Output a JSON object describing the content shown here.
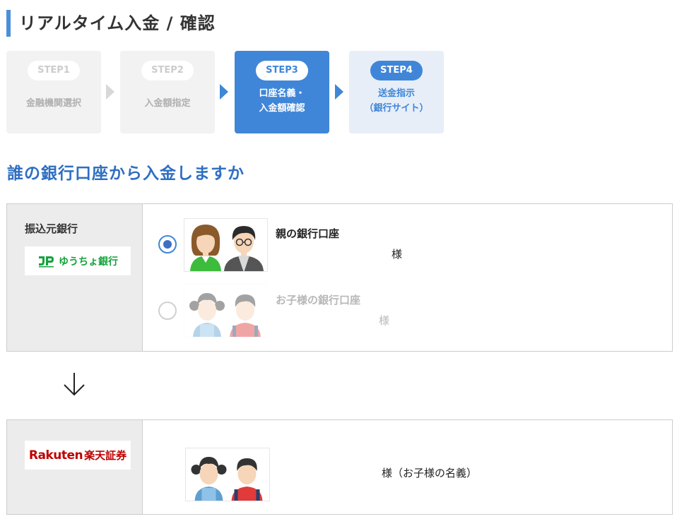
{
  "header": {
    "title": "リアルタイム入金 / 確認"
  },
  "steps": [
    {
      "pill": "STEP1",
      "label": "金融機関選択",
      "state": "done"
    },
    {
      "pill": "STEP2",
      "label": "入金額指定",
      "state": "done"
    },
    {
      "pill": "STEP3",
      "label_line1": "口座名義・",
      "label_line2": "入金額確認",
      "state": "active"
    },
    {
      "pill": "STEP4",
      "label_line1": "送金指示",
      "label_line2": "（銀行サイト）",
      "state": "next"
    }
  ],
  "question": "誰の銀行口座から入金しますか",
  "source": {
    "title": "振込元銀行",
    "bank_logo_text": "ゆうちょ銀行",
    "options": [
      {
        "label": "親の銀行口座",
        "suffix": "様",
        "selected": true,
        "enabled": true
      },
      {
        "label": "お子様の銀行口座",
        "suffix": "様",
        "selected": false,
        "enabled": false
      }
    ]
  },
  "destination": {
    "logo_text_1": "Rakuten",
    "logo_text_2": "楽天証券",
    "suffix": "様（お子様の名義）"
  },
  "colors": {
    "accent": "#3f86d8",
    "title_blue": "#2e6fc2",
    "yucho_green": "#14a33b",
    "rakuten_red": "#bf0000"
  }
}
